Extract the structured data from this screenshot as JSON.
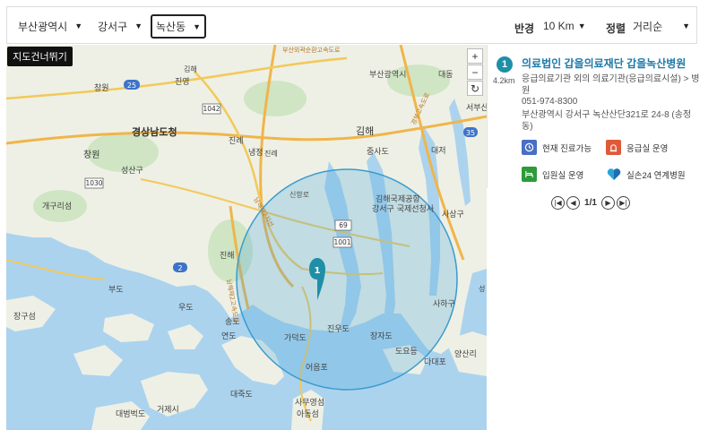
{
  "filters": {
    "city": "부산광역시",
    "district": "강서구",
    "dong": "녹산동",
    "radius_label": "반경",
    "radius_value": "10 Km",
    "sort_label": "정렬",
    "sort_value": "거리순"
  },
  "map": {
    "skip_button": "지도건너뛰기",
    "zoom_in": "+",
    "zoom_out": "−",
    "refresh": "↻",
    "marker_label": "1",
    "place_labels": [
      {
        "text": "부산광역시",
        "name": "label-busan"
      },
      {
        "text": "경상남도청",
        "name": "label-gyeongnam-office"
      },
      {
        "text": "김해",
        "name": "label-gimhae"
      },
      {
        "text": "창원",
        "name": "label-changwon"
      },
      {
        "text": "김해국제공항",
        "name": "label-gimhae-airport"
      },
      {
        "text": "강서구 국제선청사",
        "name": "label-terminal"
      },
      {
        "text": "진해",
        "name": "label-jinhae"
      },
      {
        "text": "가덕도",
        "name": "label-gadeokdo"
      },
      {
        "text": "진우도",
        "name": "label-jinudo"
      },
      {
        "text": "장자도",
        "name": "label-jangjado"
      },
      {
        "text": "도요등",
        "name": "label-doyodeung"
      },
      {
        "text": "다대포",
        "name": "label-dadaepo"
      },
      {
        "text": "양산리",
        "name": "label-yangsanri"
      },
      {
        "text": "사하구",
        "name": "label-saha"
      },
      {
        "text": "대죽도",
        "name": "label-daejukdo"
      },
      {
        "text": "어음포",
        "name": "label-eoeumpo"
      },
      {
        "text": "사무영섬",
        "name": "label-samuyeong"
      },
      {
        "text": "아동섬",
        "name": "label-adong"
      },
      {
        "text": "대범벅도",
        "name": "label-daebeom"
      },
      {
        "text": "거제시",
        "name": "label-geoje"
      },
      {
        "text": "송도",
        "name": "label-songdo"
      },
      {
        "text": "연도",
        "name": "label-yeondo"
      },
      {
        "text": "우도",
        "name": "label-udo"
      },
      {
        "text": "부도",
        "name": "label-budo"
      },
      {
        "text": "장구섬",
        "name": "label-janggu"
      },
      {
        "text": "개구리섬",
        "name": "label-gaeguri"
      },
      {
        "text": "성산구",
        "name": "label-seongsan"
      },
      {
        "text": "중사도",
        "name": "label-jungsado"
      },
      {
        "text": "대저",
        "name": "label-daejeo"
      },
      {
        "text": "대동",
        "name": "label-daedong"
      },
      {
        "text": "진영",
        "name": "label-jinyeong"
      },
      {
        "text": "진례",
        "name": "label-jinrye"
      },
      {
        "text": "냉정",
        "name": "label-naengjeong"
      },
      {
        "text": "창원",
        "name": "label-changwon-ic"
      },
      {
        "text": "서부산",
        "name": "label-seobusan"
      },
      {
        "text": "사상구",
        "name": "label-sasang"
      },
      {
        "text": "부산외곽순환고속도로",
        "name": "label-ring-expressway"
      },
      {
        "text": "남해제2지선",
        "name": "label-namhae-branch"
      },
      {
        "text": "남해제2고속도로",
        "name": "label-namhae-expressway"
      },
      {
        "text": "신항로",
        "name": "label-sinhang"
      },
      {
        "text": "경부고속도로",
        "name": "label-gyeongbu"
      },
      {
        "text": "김해",
        "name": "label-gimhae-2"
      },
      {
        "text": "진례",
        "name": "label-jinrye-2"
      },
      {
        "text": "성",
        "name": "label-seong"
      }
    ],
    "road_shields": [
      "25",
      "1042",
      "1030",
      "69",
      "1001",
      "2",
      "35"
    ]
  },
  "result": {
    "rank": "1",
    "distance": "4.2km",
    "title": "의료법인 갑을의료재단 갑을녹산병원",
    "subtitle": "응급의료기관 외의 의료기관(응급의료시설) > 병원",
    "phone": "051-974-8300",
    "address": "부산광역시 강서구 녹산산단321로 24-8 (송정동)",
    "badges": [
      {
        "label": "현재 진료가능",
        "icon": "clock-icon",
        "color": "#4a6fc2"
      },
      {
        "label": "응급실 운영",
        "icon": "siren-icon",
        "color": "#e05a3a"
      },
      {
        "label": "입원실 운영",
        "icon": "bed-icon",
        "color": "#2f9a3a"
      },
      {
        "label": "실손24 연계병원",
        "icon": "heart-icon",
        "color": "#2aa4d8"
      }
    ]
  },
  "pager": {
    "current": "1",
    "total": "1",
    "separator": "/"
  }
}
